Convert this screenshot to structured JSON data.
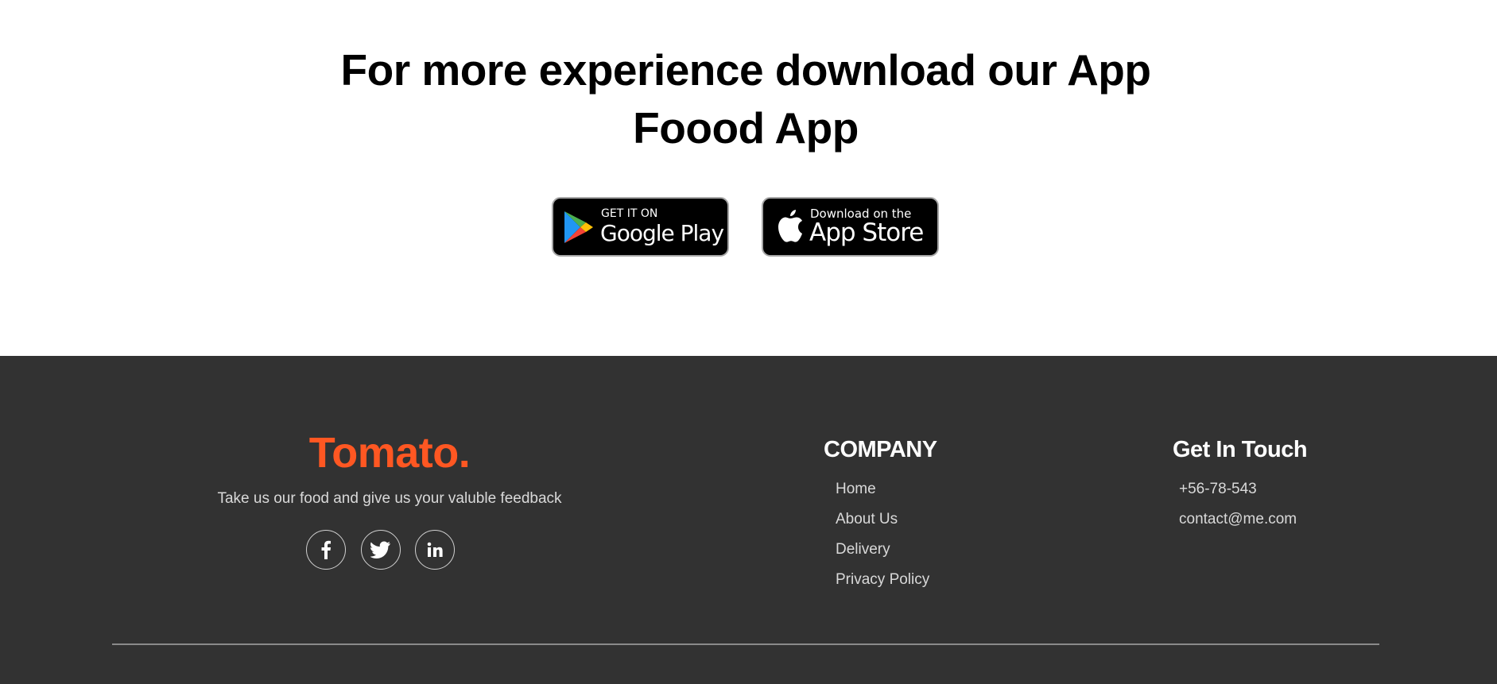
{
  "app_section": {
    "title_line1": "For more experience download our App",
    "title_line2": "Foood App",
    "google_play": {
      "small_label": "GET IT ON",
      "big_label": "Google Play"
    },
    "app_store": {
      "small_label": "Download on the",
      "big_label": "App Store"
    }
  },
  "footer": {
    "brand": {
      "logo_text": "Tomato.",
      "tagline": "Take us our food and give us your valuble feedback",
      "brand_color": "#ff5722",
      "social_icons": [
        "facebook-icon",
        "twitter-icon",
        "linkedin-icon"
      ]
    },
    "company": {
      "heading": "COMPANY",
      "links": [
        "Home",
        "About Us",
        "Delivery",
        "Privacy Policy"
      ]
    },
    "contact": {
      "heading": "Get In Touch",
      "phone": "+56-78-543",
      "email": "contact@me.com"
    },
    "background_color": "#323232"
  }
}
